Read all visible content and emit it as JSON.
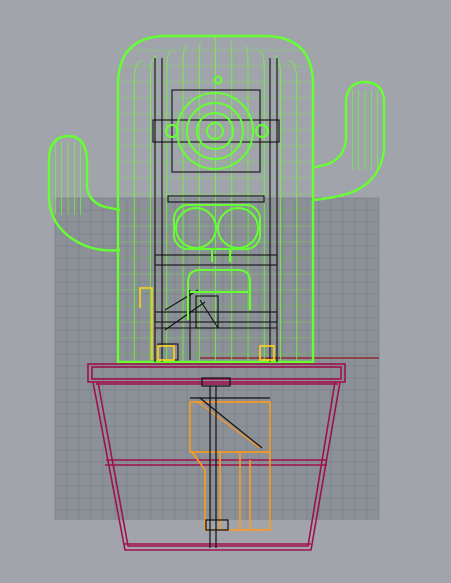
{
  "viewport": {
    "background": "#a1a5ab",
    "grid_color": "#8c9097",
    "grid_line_color": "#7c8087",
    "axis_color": "#8b1a1a"
  },
  "colors": {
    "cactus": "#66ff33",
    "cactus_dark": "#33cc11",
    "machinery": "#111111",
    "pot": "#a0104f",
    "hardware_yellow": "#ffd21a",
    "hardware_orange": "#ff9a1a"
  },
  "icons": {
    "cactus": "cactus-wireframe-icon",
    "pot": "pot-wireframe-icon",
    "mechanism": "mechanism-wireframe-icon"
  }
}
